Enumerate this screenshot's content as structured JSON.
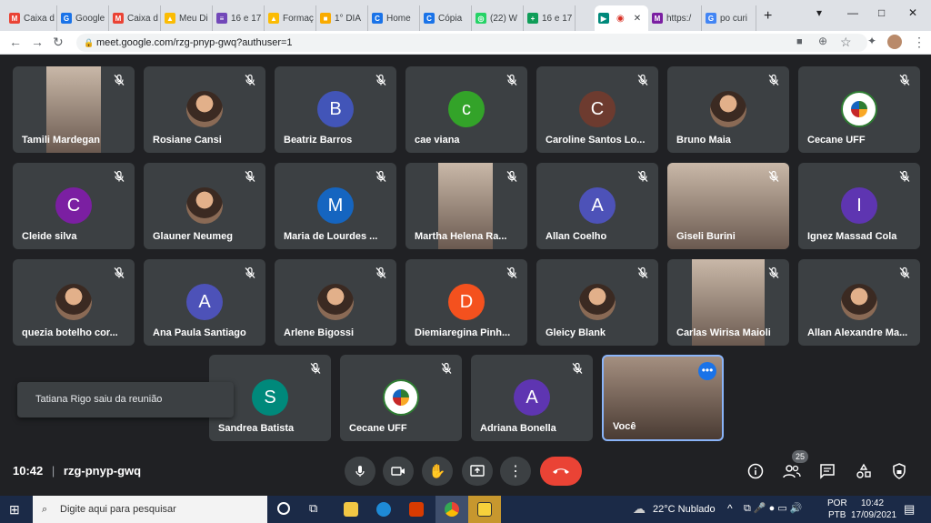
{
  "browser": {
    "tabs": [
      {
        "label": "Caixa d",
        "color": "#ea4335",
        "glyph": "M"
      },
      {
        "label": "Google",
        "color": "#1a73e8",
        "glyph": "G"
      },
      {
        "label": "Caixa d",
        "color": "#ea4335",
        "glyph": "M"
      },
      {
        "label": "Meu Di",
        "color": "#fbbc04",
        "glyph": "▲"
      },
      {
        "label": "16 e 17",
        "color": "#7248b9",
        "glyph": "≡"
      },
      {
        "label": "Formaç",
        "color": "#fbbc04",
        "glyph": "▲"
      },
      {
        "label": "1° DIA",
        "color": "#f9ab00",
        "glyph": "■"
      },
      {
        "label": "Home",
        "color": "#1a73e8",
        "glyph": "C"
      },
      {
        "label": "Cópia",
        "color": "#1a73e8",
        "glyph": "C"
      },
      {
        "label": "(22) W",
        "color": "#25d366",
        "glyph": "◎"
      },
      {
        "label": "16 e 17",
        "color": "#0f9d58",
        "glyph": "+"
      },
      {
        "label": "",
        "color": "#00897b",
        "glyph": "▶"
      },
      {
        "label": "https:/",
        "color": "#7b1fa2",
        "glyph": "M"
      },
      {
        "label": "po curi",
        "color": "#4285f4",
        "glyph": "G"
      }
    ],
    "url": "meet.google.com/rzg-pnyp-gwq?authuser=1"
  },
  "participants": [
    {
      "name": "Tamili Mardegan",
      "type": "video",
      "letter": ""
    },
    {
      "name": "Rosiane Cansi",
      "type": "photo",
      "letter": ""
    },
    {
      "name": "Beatriz Barros",
      "type": "letter",
      "letter": "B",
      "color": "#4255b8"
    },
    {
      "name": "cae viana",
      "type": "letter",
      "letter": "c",
      "color": "#33a329"
    },
    {
      "name": "Caroline Santos Lo...",
      "type": "letter",
      "letter": "C",
      "color": "#6d3b2f"
    },
    {
      "name": "Bruno Maia",
      "type": "photo",
      "letter": ""
    },
    {
      "name": "Cecane UFF",
      "type": "logo",
      "letter": ""
    },
    {
      "name": "Cleide silva",
      "type": "letter",
      "letter": "C",
      "color": "#7b1fa2"
    },
    {
      "name": "Glauner Neumeg",
      "type": "photo",
      "letter": ""
    },
    {
      "name": "Maria de Lourdes ...",
      "type": "letter",
      "letter": "M",
      "color": "#1565c0"
    },
    {
      "name": "Martha Helena Ra...",
      "type": "video",
      "letter": ""
    },
    {
      "name": "Allan Coelho",
      "type": "letter",
      "letter": "A",
      "color": "#4d52b8"
    },
    {
      "name": "Giseli Burini",
      "type": "video",
      "letter": ""
    },
    {
      "name": "Ignez Massad Cola",
      "type": "letter",
      "letter": "I",
      "color": "#5e35b1"
    },
    {
      "name": "quezia botelho cor...",
      "type": "photo",
      "letter": ""
    },
    {
      "name": "Ana Paula Santiago",
      "type": "letter",
      "letter": "A",
      "color": "#4d52b8"
    },
    {
      "name": "Arlene Bigossi",
      "type": "photo",
      "letter": ""
    },
    {
      "name": "Diemiaregina Pinh...",
      "type": "letter",
      "letter": "D",
      "color": "#f4511e"
    },
    {
      "name": "Gleicy Blank",
      "type": "photo",
      "letter": ""
    },
    {
      "name": "Carlas Wirisa Maioli",
      "type": "video",
      "letter": ""
    },
    {
      "name": "Allan Alexandre Ma...",
      "type": "photo",
      "letter": ""
    },
    {
      "name": "Sandrea Batista",
      "type": "letter",
      "letter": "S",
      "color": "#00897b"
    },
    {
      "name": "Cecane UFF",
      "type": "logo",
      "letter": ""
    },
    {
      "name": "Adriana Bonella",
      "type": "letter",
      "letter": "A",
      "color": "#5e35b1"
    },
    {
      "name": "Você",
      "type": "self",
      "letter": ""
    }
  ],
  "toast": "Tatiana Rigo saiu da reunião",
  "meeting": {
    "time": "10:42",
    "separator": "|",
    "code": "rzg-pnyp-gwq",
    "participant_count": "25"
  },
  "taskbar": {
    "search_placeholder": "Digite aqui para pesquisar",
    "weather": "22°C  Nublado",
    "lang_top": "POR",
    "lang_bottom": "PTB",
    "clock_time": "10:42",
    "clock_date": "17/09/2021"
  }
}
